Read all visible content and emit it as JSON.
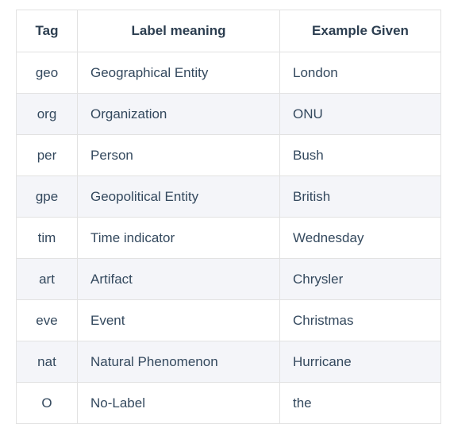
{
  "table": {
    "caption": "",
    "columns": [
      {
        "key": "tag",
        "label": "Tag",
        "align": "center"
      },
      {
        "key": "meaning",
        "label": "Label meaning",
        "align": "left"
      },
      {
        "key": "example",
        "label": "Example Given",
        "align": "left"
      }
    ],
    "rows": [
      {
        "tag": "geo",
        "meaning": "Geographical Entity",
        "example": "London"
      },
      {
        "tag": "org",
        "meaning": "Organization",
        "example": "ONU"
      },
      {
        "tag": "per",
        "meaning": "Person",
        "example": "Bush"
      },
      {
        "tag": "gpe",
        "meaning": "Geopolitical Entity",
        "example": "British"
      },
      {
        "tag": "tim",
        "meaning": "Time indicator",
        "example": "Wednesday"
      },
      {
        "tag": "art",
        "meaning": "Artifact",
        "example": "Chrysler"
      },
      {
        "tag": "eve",
        "meaning": "Event",
        "example": "Christmas"
      },
      {
        "tag": "nat",
        "meaning": "Natural Phenomenon",
        "example": "Hurricane"
      },
      {
        "tag": "O",
        "meaning": "No-Label",
        "example": "the"
      }
    ],
    "colors": {
      "header_text": "#2c3e50",
      "body_text": "#34495e",
      "border": "#e2e2e2",
      "outer_border": "#dcdcdc",
      "row_stripe": "#f4f5f9",
      "row_plain": "#ffffff",
      "page_background": "#ffffff"
    }
  }
}
